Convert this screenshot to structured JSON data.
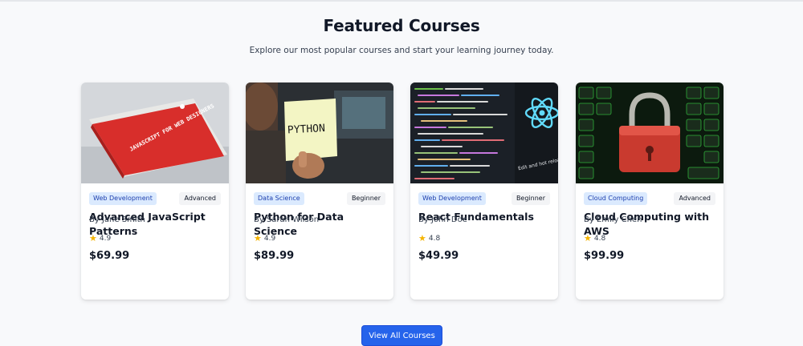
{
  "section": {
    "title": "Featured Courses",
    "subtitle": "Explore our most popular courses and start your learning journey today."
  },
  "courses": [
    {
      "image_icon": "javascript-book-image",
      "image_text": "JAVASCRIPT FOR WEB DESIGNERS",
      "category": "Web Development",
      "level": "Advanced",
      "title": "Advanced JavaScript Patterns",
      "instructor": "By Jane Smith",
      "rating": "4.9",
      "price": "$69.99"
    },
    {
      "image_icon": "python-sticky-note-image",
      "image_text": "PYTHON",
      "category": "Data Science",
      "level": "Beginner",
      "title": "Python for Data Science",
      "instructor": "By Sarah Wilson",
      "rating": "4.9",
      "price": "$89.99"
    },
    {
      "image_icon": "react-code-screen-image",
      "image_text": "Edit and hot reload",
      "category": "Web Development",
      "level": "Beginner",
      "title": "React Fundamentals",
      "instructor": "By John Doe",
      "rating": "4.8",
      "price": "$49.99"
    },
    {
      "image_icon": "padlock-keyboard-image",
      "image_text": "",
      "category": "Cloud Computing",
      "level": "Advanced",
      "title": "Cloud Computing with AWS",
      "instructor": "By Emily Chen",
      "rating": "4.8",
      "price": "$99.99"
    }
  ],
  "cta": {
    "label": "View All Courses"
  },
  "colors": {
    "accent": "#2563eb",
    "badge_bg": "#dbeafe",
    "badge_text": "#1e40af",
    "star": "#f5b400"
  }
}
